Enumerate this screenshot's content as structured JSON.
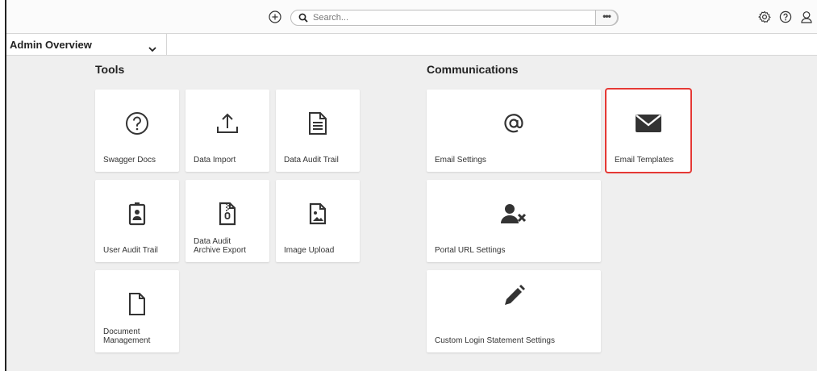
{
  "topbar": {
    "search_placeholder": "Search...",
    "more_label": "•••",
    "icons": [
      "plus-circle-icon",
      "search-icon",
      "gear-icon",
      "help-icon",
      "user-icon"
    ]
  },
  "subbar": {
    "view_label": "Admin Overview"
  },
  "tools": {
    "title": "Tools",
    "tiles": [
      {
        "label": "Swagger Docs",
        "icon": "question-circle-icon"
      },
      {
        "label": "Data Import",
        "icon": "upload-icon"
      },
      {
        "label": "Data Audit Trail",
        "icon": "document-lines-icon"
      },
      {
        "label": "User Audit Trail",
        "icon": "id-badge-icon"
      },
      {
        "label": "Data Audit\nArchive Export",
        "icon": "zip-file-icon"
      },
      {
        "label": "Image Upload",
        "icon": "image-file-icon"
      },
      {
        "label": "Document\nManagement",
        "icon": "blank-document-icon"
      }
    ]
  },
  "communications": {
    "title": "Communications",
    "tiles": [
      {
        "label": "Email Settings",
        "icon": "at-sign-icon"
      },
      {
        "label": "Email Templates",
        "icon": "envelope-icon"
      },
      {
        "label": "Portal URL Settings",
        "icon": "user-x-icon"
      },
      {
        "label": "Custom Login Statement Settings",
        "icon": "pencil-icon"
      }
    ]
  },
  "colors": {
    "highlight": "#e53935",
    "icon": "#333333",
    "tile_bg": "#ffffff",
    "canvas_bg": "#efefef"
  }
}
